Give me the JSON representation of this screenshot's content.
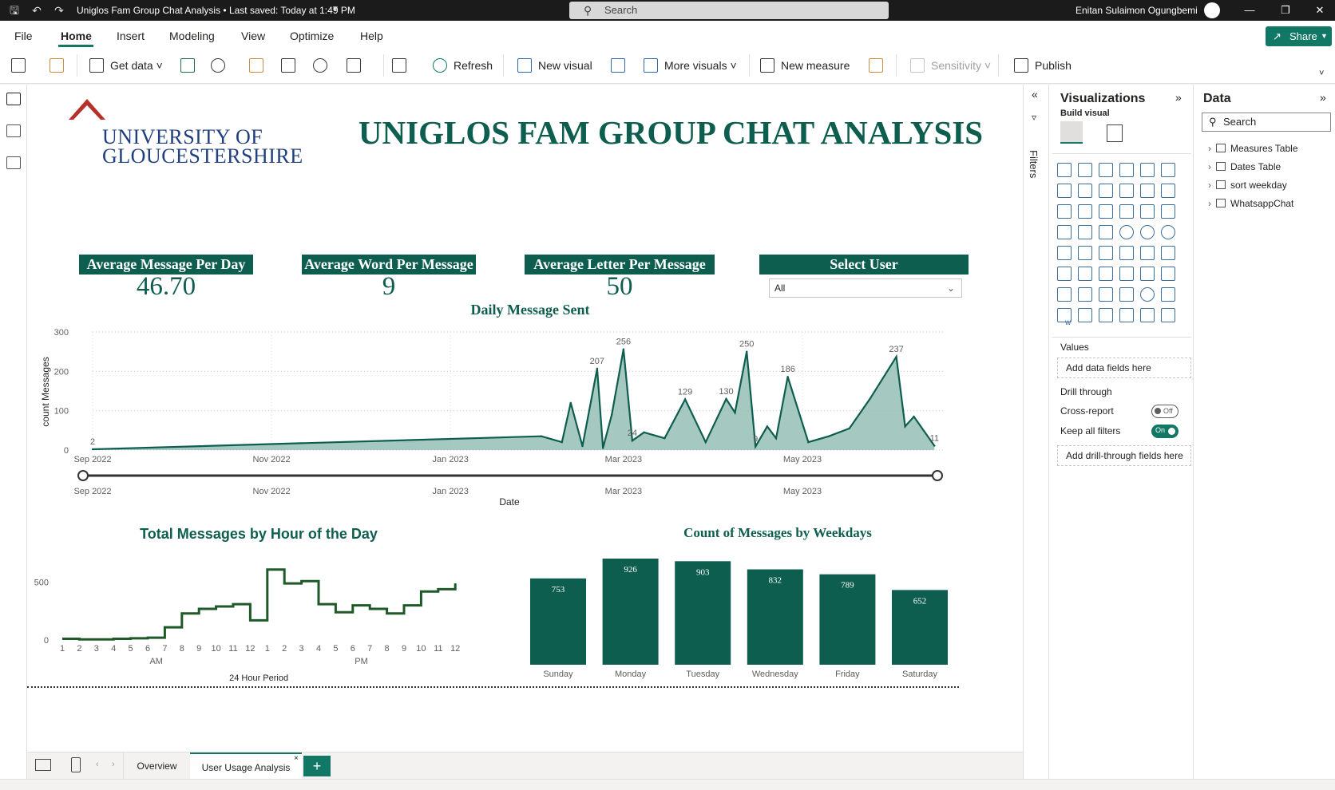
{
  "titlebar": {
    "title": "Uniglos Fam Group Chat Analysis • Last saved: Today at 1:49 PM",
    "search_placeholder": "Search",
    "user_name": "Enitan Sulaimon Ogungbemi"
  },
  "menu": {
    "items": [
      "File",
      "Home",
      "Insert",
      "Modeling",
      "View",
      "Optimize",
      "Help"
    ],
    "active": "Home",
    "share_label": "Share"
  },
  "ribbon": {
    "get_data": "Get data",
    "refresh": "Refresh",
    "new_visual": "New visual",
    "more_visuals": "More visuals",
    "new_measure": "New measure",
    "sensitivity": "Sensitivity",
    "publish": "Publish"
  },
  "report": {
    "logo_line1": "UNIVERSITY OF",
    "logo_line2": "GLOUCESTERSHIRE",
    "title": "UNIGLOS FAM GROUP CHAT ANALYSIS",
    "cards": [
      {
        "label": "Average Message Per Day",
        "value": "46.70"
      },
      {
        "label": "Average Word Per Message",
        "value": "9"
      },
      {
        "label": "Average Letter Per Message",
        "value": "50"
      }
    ],
    "slicer": {
      "label": "Select User",
      "value": "All"
    }
  },
  "daily_chart": {
    "title": "Daily Message Sent",
    "ylabel": "count Messages",
    "xlabel": "Date",
    "y_ticks": [
      "300",
      "200",
      "100",
      "0"
    ],
    "x_ticks": [
      "Sep 2022",
      "Nov 2022",
      "Jan 2023",
      "Mar 2023",
      "May 2023"
    ],
    "slider_ticks": [
      "Sep 2022",
      "Nov 2022",
      "Jan 2023",
      "Mar 2023",
      "May 2023"
    ]
  },
  "hour_chart": {
    "title": "Total Messages by Hour of the Day",
    "xlabel": "24 Hour Period",
    "y_ticks": [
      "500",
      "0"
    ],
    "hour_labels": [
      "1",
      "2",
      "3",
      "4",
      "5",
      "6",
      "7",
      "8",
      "9",
      "10",
      "11",
      "12",
      "1",
      "2",
      "3",
      "4",
      "5",
      "6",
      "7",
      "8",
      "9",
      "10",
      "11",
      "12"
    ],
    "am_label": "AM",
    "pm_label": "PM"
  },
  "weekday_chart": {
    "title": "Count of Messages by Weekdays"
  },
  "chart_data": [
    {
      "type": "area",
      "title": "Daily Message Sent",
      "xlabel": "Date",
      "ylabel": "count Messages",
      "ylim": [
        0,
        300
      ],
      "grid": true,
      "x": [
        "2022-09-01",
        "2023-02-01",
        "2023-02-08",
        "2023-02-11",
        "2023-02-15",
        "2023-02-20",
        "2023-02-22",
        "2023-02-25",
        "2023-03-01",
        "2023-03-04",
        "2023-03-08",
        "2023-03-15",
        "2023-03-22",
        "2023-03-29",
        "2023-04-05",
        "2023-04-08",
        "2023-04-12",
        "2023-04-15",
        "2023-04-19",
        "2023-04-22",
        "2023-04-26",
        "2023-05-03",
        "2023-05-10",
        "2023-05-17",
        "2023-05-24",
        "2023-06-02",
        "2023-06-05",
        "2023-06-08",
        "2023-06-15"
      ],
      "values": [
        2,
        35,
        20,
        120,
        10,
        207,
        5,
        90,
        256,
        24,
        45,
        30,
        129,
        20,
        130,
        95,
        250,
        9,
        60,
        30,
        186,
        20,
        35,
        55,
        130,
        237,
        60,
        85,
        11
      ],
      "data_labels": [
        {
          "x": "2022-09-01",
          "y": 2
        },
        {
          "x": "2023-02-20",
          "y": 207
        },
        {
          "x": "2023-03-01",
          "y": 256
        },
        {
          "x": "2023-03-04",
          "y": 24
        },
        {
          "x": "2023-03-22",
          "y": 129
        },
        {
          "x": "2023-04-05",
          "y": 130
        },
        {
          "x": "2023-04-12",
          "y": 250
        },
        {
          "x": "2023-04-15",
          "y": 9
        },
        {
          "x": "2023-04-26",
          "y": 186
        },
        {
          "x": "2023-06-02",
          "y": 237
        },
        {
          "x": "2023-06-15",
          "y": 11
        }
      ]
    },
    {
      "type": "line",
      "title": "Total Messages by Hour of the Day",
      "xlabel": "24 Hour Period",
      "x": [
        "1 AM",
        "2 AM",
        "3 AM",
        "4 AM",
        "5 AM",
        "6 AM",
        "7 AM",
        "8 AM",
        "9 AM",
        "10 AM",
        "11 AM",
        "12 AM",
        "1 PM",
        "2 PM",
        "3 PM",
        "4 PM",
        "5 PM",
        "6 PM",
        "7 PM",
        "8 PM",
        "9 PM",
        "10 PM",
        "11 PM",
        "12 PM"
      ],
      "values": [
        10,
        5,
        5,
        10,
        15,
        20,
        110,
        230,
        270,
        290,
        310,
        170,
        610,
        490,
        510,
        310,
        240,
        300,
        270,
        230,
        300,
        420,
        440,
        490
      ],
      "ylim": [
        0,
        650
      ],
      "step": true
    },
    {
      "type": "bar",
      "title": "Count of Messages by Weekdays",
      "categories": [
        "Sunday",
        "Monday",
        "Tuesday",
        "Wednesday",
        "Friday",
        "Saturday"
      ],
      "values": [
        753,
        926,
        903,
        832,
        789,
        652
      ],
      "ylim": [
        0,
        926
      ]
    }
  ],
  "viz_pane": {
    "title": "Visualizations",
    "build_visual": "Build visual",
    "values_label": "Values",
    "values_well": "Add data fields here",
    "drill_through": "Drill through",
    "cross_report": "Cross-report",
    "cross_report_state": "Off",
    "keep_filters": "Keep all filters",
    "keep_filters_state": "On",
    "drill_well": "Add drill-through fields here"
  },
  "filters_label": "Filters",
  "data_pane": {
    "title": "Data",
    "search_placeholder": "Search",
    "tables": [
      "Measures Table",
      "Dates Table",
      "sort weekday",
      "WhatsappChat"
    ]
  },
  "tabs": {
    "pages": [
      "Overview",
      "User Usage Analysis"
    ],
    "active": "User Usage Analysis",
    "add": "+"
  },
  "colors": {
    "accent": "#117865",
    "chart_green": "#0e5e4f",
    "area_fill": "#8fbab1",
    "hour_line": "#1e5a28",
    "logo_red": "#b5322a",
    "logo_blue": "#1f3f7f"
  }
}
